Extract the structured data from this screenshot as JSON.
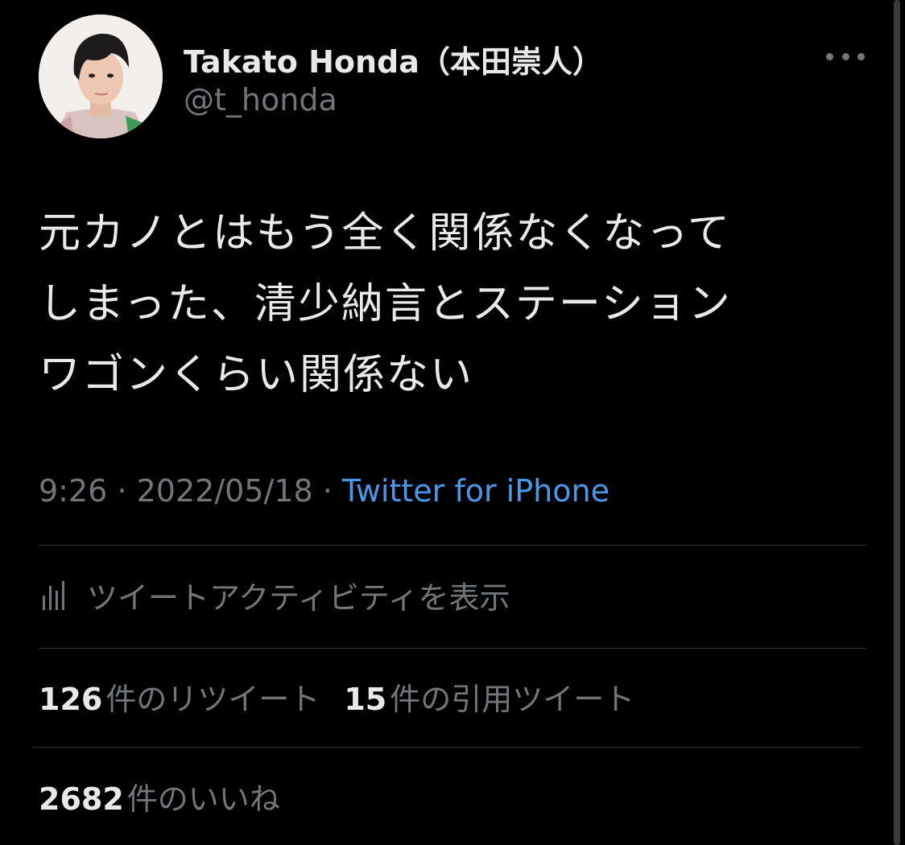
{
  "user": {
    "display_name": "Takato Honda（本田崇人）",
    "handle": "@t_honda",
    "avatar_icon": "avatar-photo"
  },
  "tweet": {
    "lines": [
      "元カノとはもう全く関係なくなって",
      "しまった、清少納言とステーション",
      "ワゴンくらい関係ない"
    ],
    "time": "9:26",
    "date": "2022/05/18",
    "separator": "·",
    "source": "Twitter for iPhone"
  },
  "activity": {
    "icon": "bar-chart-icon",
    "label": "ツイートアクティビティを表示"
  },
  "stats": {
    "retweets": {
      "count": "126",
      "label": "件のリツイート"
    },
    "quotes": {
      "count": "15",
      "label": "件の引用ツイート"
    },
    "likes": {
      "count": "2682",
      "label": "件のいいね"
    }
  },
  "colors": {
    "background": "#000000",
    "primary_text": "#e7e9ea",
    "secondary_text": "#71767b",
    "link": "#4a99e9",
    "divider": "#2f3336"
  }
}
